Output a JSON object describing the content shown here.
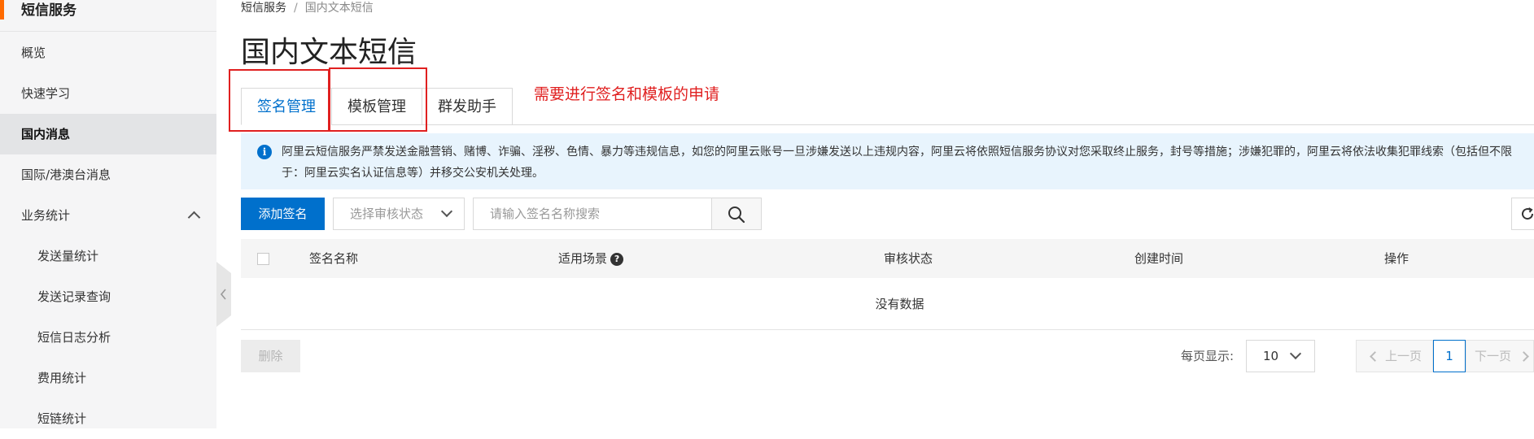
{
  "sidebar": {
    "title": "短信服务",
    "items": [
      {
        "label": "概览",
        "level": 1
      },
      {
        "label": "快速学习",
        "level": 1
      },
      {
        "label": "国内消息",
        "level": 1,
        "active": true
      },
      {
        "label": "国际/港澳台消息",
        "level": 1
      },
      {
        "label": "业务统计",
        "level": 1,
        "expanded": true
      },
      {
        "label": "发送量统计",
        "level": 2
      },
      {
        "label": "发送记录查询",
        "level": 2
      },
      {
        "label": "短信日志分析",
        "level": 2
      },
      {
        "label": "费用统计",
        "level": 2
      },
      {
        "label": "短链统计",
        "level": 2
      }
    ]
  },
  "breadcrumb": {
    "root": "短信服务",
    "separator": "/",
    "current": "国内文本短信"
  },
  "page_title": "国内文本短信",
  "tabs": [
    {
      "label": "签名管理",
      "active": true
    },
    {
      "label": "模板管理",
      "active": false
    },
    {
      "label": "群发助手",
      "active": false
    }
  ],
  "annotation": "需要进行签名和模板的申请",
  "notice": {
    "icon": "info-icon",
    "text": "阿里云短信服务严禁发送金融营销、赌博、诈骗、淫秽、色情、暴力等违规信息，如您的阿里云账号一旦涉嫌发送以上违规内容，阿里云将依照短信服务协议对您采取终止服务，封号等措施；涉嫌犯罪的，阿里云将依法收集犯罪线索（包括但不限于：阿里云实名认证信息等）并移交公安机关处理。"
  },
  "toolbar": {
    "add_label": "添加签名",
    "status_placeholder": "选择审核状态",
    "search_placeholder": "请输入签名名称搜索"
  },
  "table": {
    "columns": [
      "签名名称",
      "适用场景",
      "审核状态",
      "创建时间",
      "操作"
    ],
    "empty_text": "没有数据"
  },
  "footer": {
    "delete_label": "删除",
    "per_page_label": "每页显示:",
    "per_page_value": "10",
    "prev_label": "上一页",
    "current_page": "1",
    "next_label": "下一页"
  },
  "colors": {
    "primary": "#0070cc",
    "accent": "#ff6a00",
    "annotation": "#e02020",
    "notice_bg": "#e8f4fd"
  }
}
